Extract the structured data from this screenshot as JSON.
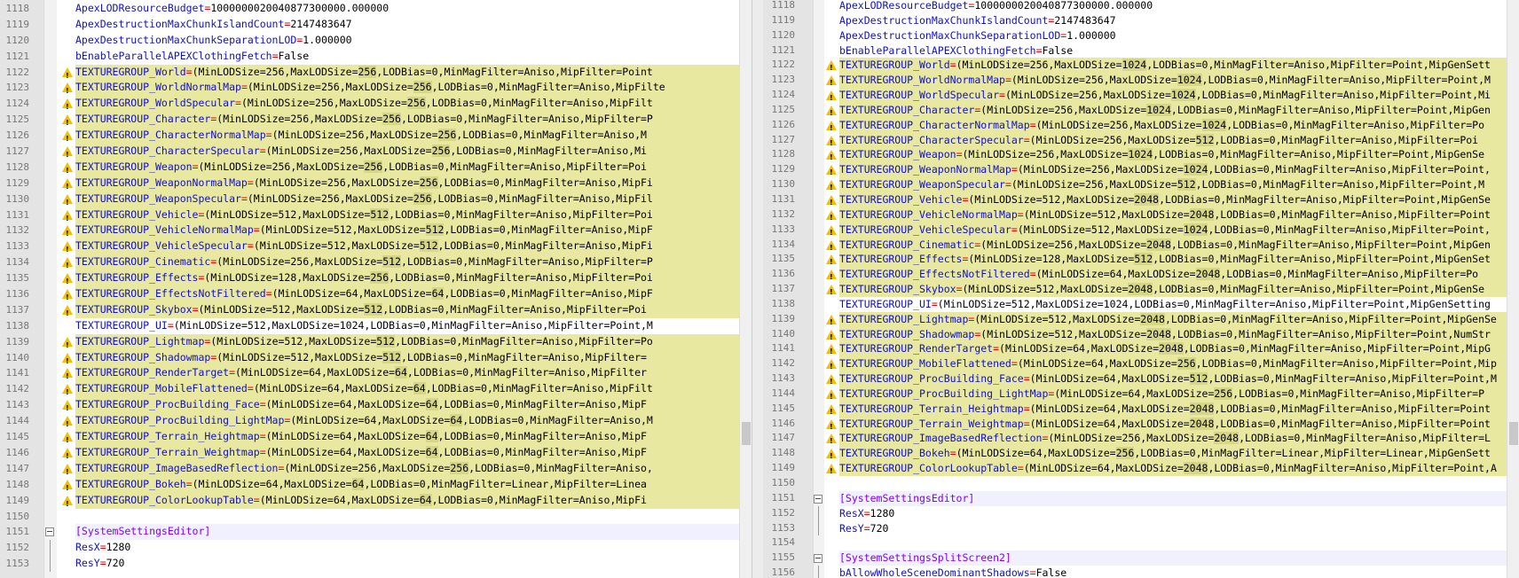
{
  "left_pane": {
    "lines": [
      {
        "num": "1118",
        "key": "ApexLODResourceBudget",
        "value": "1000000020040877300000.000000",
        "warn": false
      },
      {
        "num": "1119",
        "key": "ApexDestructionMaxChunkIslandCount",
        "value": "2147483647",
        "warn": false
      },
      {
        "num": "1120",
        "key": "ApexDestructionMaxChunkSeparationLOD",
        "value": "1.000000",
        "warn": false
      },
      {
        "num": "1121",
        "key": "bEnableParallelAPEXClothingFetch",
        "value": "False",
        "warn": false
      },
      {
        "num": "1122",
        "key": "TEXTUREGROUP_World",
        "pre": "(MinLODSize=256,MaxLODSize=",
        "mark": "256",
        "post": ",LODBias=0,MinMagFilter=Aniso,MipFilter=Point",
        "warn": true
      },
      {
        "num": "1123",
        "key": "TEXTUREGROUP_WorldNormalMap",
        "pre": "(MinLODSize=256,MaxLODSize=",
        "mark": "256",
        "post": ",LODBias=0,MinMagFilter=Aniso,MipFilte",
        "warn": true
      },
      {
        "num": "1124",
        "key": "TEXTUREGROUP_WorldSpecular",
        "pre": "(MinLODSize=256,MaxLODSize=",
        "mark": "256",
        "post": ",LODBias=0,MinMagFilter=Aniso,MipFilt",
        "warn": true
      },
      {
        "num": "1125",
        "key": "TEXTUREGROUP_Character",
        "pre": "(MinLODSize=256,MaxLODSize=",
        "mark": "256",
        "post": ",LODBias=0,MinMagFilter=Aniso,MipFilter=P",
        "warn": true
      },
      {
        "num": "1126",
        "key": "TEXTUREGROUP_CharacterNormalMap",
        "pre": "(MinLODSize=256,MaxLODSize=",
        "mark": "256",
        "post": ",LODBias=0,MinMagFilter=Aniso,M",
        "warn": true
      },
      {
        "num": "1127",
        "key": "TEXTUREGROUP_CharacterSpecular",
        "pre": "(MinLODSize=256,MaxLODSize=",
        "mark": "256",
        "post": ",LODBias=0,MinMagFilter=Aniso,Mi",
        "warn": true
      },
      {
        "num": "1128",
        "key": "TEXTUREGROUP_Weapon",
        "pre": "(MinLODSize=256,MaxLODSize=",
        "mark": "256",
        "post": ",LODBias=0,MinMagFilter=Aniso,MipFilter=Poi",
        "warn": true
      },
      {
        "num": "1129",
        "key": "TEXTUREGROUP_WeaponNormalMap",
        "pre": "(MinLODSize=256,MaxLODSize=",
        "mark": "256",
        "post": ",LODBias=0,MinMagFilter=Aniso,MipFi",
        "warn": true
      },
      {
        "num": "1130",
        "key": "TEXTUREGROUP_WeaponSpecular",
        "pre": "(MinLODSize=256,MaxLODSize=",
        "mark": "256",
        "post": ",LODBias=0,MinMagFilter=Aniso,MipFil",
        "warn": true
      },
      {
        "num": "1131",
        "key": "TEXTUREGROUP_Vehicle",
        "pre": "(MinLODSize=512,MaxLODSize=",
        "mark": "512",
        "post": ",LODBias=0,MinMagFilter=Aniso,MipFilter=Poi",
        "warn": true
      },
      {
        "num": "1132",
        "key": "TEXTUREGROUP_VehicleNormalMap",
        "pre": "(MinLODSize=512,MaxLODSize=",
        "mark": "512",
        "post": ",LODBias=0,MinMagFilter=Aniso,MipF",
        "warn": true
      },
      {
        "num": "1133",
        "key": "TEXTUREGROUP_VehicleSpecular",
        "pre": "(MinLODSize=512,MaxLODSize=",
        "mark": "512",
        "post": ",LODBias=0,MinMagFilter=Aniso,MipFi",
        "warn": true
      },
      {
        "num": "1134",
        "key": "TEXTUREGROUP_Cinematic",
        "pre": "(MinLODSize=256,MaxLODSize=",
        "mark": "512",
        "post": ",LODBias=0,MinMagFilter=Aniso,MipFilter=P",
        "warn": true
      },
      {
        "num": "1135",
        "key": "TEXTUREGROUP_Effects",
        "pre": "(MinLODSize=128,MaxLODSize=",
        "mark": "256",
        "post": ",LODBias=0,MinMagFilter=Aniso,MipFilter=Poi",
        "warn": true
      },
      {
        "num": "1136",
        "key": "TEXTUREGROUP_EffectsNotFiltered",
        "pre": "(MinLODSize=64,MaxLODSize=",
        "mark": "64",
        "post": ",LODBias=0,MinMagFilter=Aniso,MipF",
        "warn": true
      },
      {
        "num": "1137",
        "key": "TEXTUREGROUP_Skybox",
        "pre": "(MinLODSize=512,MaxLODSize=",
        "mark": "512",
        "post": ",LODBias=0,MinMagFilter=Aniso,MipFilter=Poi",
        "warn": true
      },
      {
        "num": "1138",
        "key": "TEXTUREGROUP_UI",
        "value": "(MinLODSize=512,MaxLODSize=1024,LODBias=0,MinMagFilter=Aniso,MipFilter=Point,M",
        "warn": false
      },
      {
        "num": "1139",
        "key": "TEXTUREGROUP_Lightmap",
        "pre": "(MinLODSize=512,MaxLODSize=",
        "mark": "512",
        "post": ",LODBias=0,MinMagFilter=Aniso,MipFilter=Po",
        "warn": true
      },
      {
        "num": "1140",
        "key": "TEXTUREGROUP_Shadowmap",
        "pre": "(MinLODSize=512,MaxLODSize=",
        "mark": "512",
        "post": ",LODBias=0,MinMagFilter=Aniso,MipFilter=",
        "warn": true
      },
      {
        "num": "1141",
        "key": "TEXTUREGROUP_RenderTarget",
        "pre": "(MinLODSize=64,MaxLODSize=",
        "mark": "64",
        "post": ",LODBias=0,MinMagFilter=Aniso,MipFilter",
        "warn": true
      },
      {
        "num": "1142",
        "key": "TEXTUREGROUP_MobileFlattened",
        "pre": "(MinLODSize=64,MaxLODSize=",
        "mark": "64",
        "post": ",LODBias=0,MinMagFilter=Aniso,MipFilt",
        "warn": true
      },
      {
        "num": "1143",
        "key": "TEXTUREGROUP_ProcBuilding_Face",
        "pre": "(MinLODSize=64,MaxLODSize=",
        "mark": "64",
        "post": ",LODBias=0,MinMagFilter=Aniso,MipF",
        "warn": true
      },
      {
        "num": "1144",
        "key": "TEXTUREGROUP_ProcBuilding_LightMap",
        "pre": "(MinLODSize=64,MaxLODSize=",
        "mark": "64",
        "post": ",LODBias=0,MinMagFilter=Aniso,M",
        "warn": true
      },
      {
        "num": "1145",
        "key": "TEXTUREGROUP_Terrain_Heightmap",
        "pre": "(MinLODSize=64,MaxLODSize=",
        "mark": "64",
        "post": ",LODBias=0,MinMagFilter=Aniso,MipF",
        "warn": true
      },
      {
        "num": "1146",
        "key": "TEXTUREGROUP_Terrain_Weightmap",
        "pre": "(MinLODSize=64,MaxLODSize=",
        "mark": "64",
        "post": ",LODBias=0,MinMagFilter=Aniso,MipF",
        "warn": true
      },
      {
        "num": "1147",
        "key": "TEXTUREGROUP_ImageBasedReflection",
        "pre": "(MinLODSize=256,MaxLODSize=",
        "mark": "256",
        "post": ",LODBias=0,MinMagFilter=Aniso,",
        "warn": true
      },
      {
        "num": "1148",
        "key": "TEXTUREGROUP_Bokeh",
        "pre": "(MinLODSize=64,MaxLODSize=",
        "mark": "64",
        "post": ",LODBias=0,MinMagFilter=Linear,MipFilter=Linea",
        "warn": true
      },
      {
        "num": "1149",
        "key": "TEXTUREGROUP_ColorLookupTable",
        "pre": "(MinLODSize=64,MaxLODSize=",
        "mark": "64",
        "post": ",LODBias=0,MinMagFilter=Aniso,MipFi",
        "warn": true
      },
      {
        "num": "1150",
        "blank": true
      },
      {
        "num": "1151",
        "section": "[SystemSettingsEditor]"
      },
      {
        "num": "1152",
        "key": "ResX",
        "value": "1280",
        "warn": false
      },
      {
        "num": "1153",
        "key": "ResY",
        "value": "720",
        "warn": false
      }
    ]
  },
  "right_pane": {
    "lines": [
      {
        "num": "1118",
        "key": "ApexLODResourceBudget",
        "value": "1000000020040877300000.000000",
        "warn": false
      },
      {
        "num": "1119",
        "key": "ApexDestructionMaxChunkIslandCount",
        "value": "2147483647",
        "warn": false
      },
      {
        "num": "1120",
        "key": "ApexDestructionMaxChunkSeparationLOD",
        "value": "1.000000",
        "warn": false
      },
      {
        "num": "1121",
        "key": "bEnableParallelAPEXClothingFetch",
        "value": "False",
        "warn": false
      },
      {
        "num": "1122",
        "key": "TEXTUREGROUP_World",
        "pre": "(MinLODSize=256,MaxLODSize=",
        "mark": "1024",
        "post": ",LODBias=0,MinMagFilter=Aniso,MipFilter=Point,MipGenSett",
        "warn": true
      },
      {
        "num": "1123",
        "key": "TEXTUREGROUP_WorldNormalMap",
        "pre": "(MinLODSize=256,MaxLODSize=",
        "mark": "1024",
        "post": ",LODBias=0,MinMagFilter=Aniso,MipFilter=Point,M",
        "warn": true
      },
      {
        "num": "1124",
        "key": "TEXTUREGROUP_WorldSpecular",
        "pre": "(MinLODSize=256,MaxLODSize=",
        "mark": "1024",
        "post": ",LODBias=0,MinMagFilter=Aniso,MipFilter=Point,Mi",
        "warn": true
      },
      {
        "num": "1125",
        "key": "TEXTUREGROUP_Character",
        "pre": "(MinLODSize=256,MaxLODSize=",
        "mark": "1024",
        "post": ",LODBias=0,MinMagFilter=Aniso,MipFilter=Point,MipGen",
        "warn": true
      },
      {
        "num": "1126",
        "key": "TEXTUREGROUP_CharacterNormalMap",
        "pre": "(MinLODSize=256,MaxLODSize=",
        "mark": "1024",
        "post": ",LODBias=0,MinMagFilter=Aniso,MipFilter=Po",
        "warn": true
      },
      {
        "num": "1127",
        "key": "TEXTUREGROUP_CharacterSpecular",
        "pre": "(MinLODSize=256,MaxLODSize=",
        "mark": "512",
        "post": ",LODBias=0,MinMagFilter=Aniso,MipFilter=Poi",
        "warn": true
      },
      {
        "num": "1128",
        "key": "TEXTUREGROUP_Weapon",
        "pre": "(MinLODSize=256,MaxLODSize=",
        "mark": "1024",
        "post": ",LODBias=0,MinMagFilter=Aniso,MipFilter=Point,MipGenSe",
        "warn": true
      },
      {
        "num": "1129",
        "key": "TEXTUREGROUP_WeaponNormalMap",
        "pre": "(MinLODSize=256,MaxLODSize=",
        "mark": "1024",
        "post": ",LODBias=0,MinMagFilter=Aniso,MipFilter=Point,",
        "warn": true
      },
      {
        "num": "1130",
        "key": "TEXTUREGROUP_WeaponSpecular",
        "pre": "(MinLODSize=256,MaxLODSize=",
        "mark": "512",
        "post": ",LODBias=0,MinMagFilter=Aniso,MipFilter=Point,M",
        "warn": true
      },
      {
        "num": "1131",
        "key": "TEXTUREGROUP_Vehicle",
        "pre": "(MinLODSize=512,MaxLODSize=",
        "mark": "2048",
        "post": ",LODBias=0,MinMagFilter=Aniso,MipFilter=Point,MipGenSe",
        "warn": true
      },
      {
        "num": "1132",
        "key": "TEXTUREGROUP_VehicleNormalMap",
        "pre": "(MinLODSize=512,MaxLODSize=",
        "mark": "2048",
        "post": ",LODBias=0,MinMagFilter=Aniso,MipFilter=Point",
        "warn": true
      },
      {
        "num": "1133",
        "key": "TEXTUREGROUP_VehicleSpecular",
        "pre": "(MinLODSize=512,MaxLODSize=",
        "mark": "1024",
        "post": ",LODBias=0,MinMagFilter=Aniso,MipFilter=Point,",
        "warn": true
      },
      {
        "num": "1134",
        "key": "TEXTUREGROUP_Cinematic",
        "pre": "(MinLODSize=256,MaxLODSize=",
        "mark": "2048",
        "post": ",LODBias=0,MinMagFilter=Aniso,MipFilter=Point,MipGen",
        "warn": true
      },
      {
        "num": "1135",
        "key": "TEXTUREGROUP_Effects",
        "pre": "(MinLODSize=128,MaxLODSize=",
        "mark": "512",
        "post": ",LODBias=0,MinMagFilter=Aniso,MipFilter=Point,MipGenSet",
        "warn": true
      },
      {
        "num": "1136",
        "key": "TEXTUREGROUP_EffectsNotFiltered",
        "pre": "(MinLODSize=64,MaxLODSize=",
        "mark": "2048",
        "post": ",LODBias=0,MinMagFilter=Aniso,MipFilter=Po",
        "warn": true
      },
      {
        "num": "1137",
        "key": "TEXTUREGROUP_Skybox",
        "pre": "(MinLODSize=512,MaxLODSize=",
        "mark": "2048",
        "post": ",LODBias=0,MinMagFilter=Aniso,MipFilter=Point,MipGenSe",
        "warn": true
      },
      {
        "num": "1138",
        "key": "TEXTUREGROUP_UI",
        "value": "(MinLODSize=512,MaxLODSize=1024,LODBias=0,MinMagFilter=Aniso,MipFilter=Point,MipGenSetting",
        "warn": false
      },
      {
        "num": "1139",
        "key": "TEXTUREGROUP_Lightmap",
        "pre": "(MinLODSize=512,MaxLODSize=",
        "mark": "2048",
        "post": ",LODBias=0,MinMagFilter=Aniso,MipFilter=Point,MipGenSe",
        "warn": true
      },
      {
        "num": "1140",
        "key": "TEXTUREGROUP_Shadowmap",
        "pre": "(MinLODSize=512,MaxLODSize=",
        "mark": "2048",
        "post": ",LODBias=0,MinMagFilter=Aniso,MipFilter=Point,NumStr",
        "warn": true
      },
      {
        "num": "1141",
        "key": "TEXTUREGROUP_RenderTarget",
        "pre": "(MinLODSize=64,MaxLODSize=",
        "mark": "2048",
        "post": ",LODBias=0,MinMagFilter=Aniso,MipFilter=Point,MipG",
        "warn": true
      },
      {
        "num": "1142",
        "key": "TEXTUREGROUP_MobileFlattened",
        "pre": "(MinLODSize=64,MaxLODSize=",
        "mark": "256",
        "post": ",LODBias=0,MinMagFilter=Aniso,MipFilter=Point,Mip",
        "warn": true
      },
      {
        "num": "1143",
        "key": "TEXTUREGROUP_ProcBuilding_Face",
        "pre": "(MinLODSize=64,MaxLODSize=",
        "mark": "512",
        "post": ",LODBias=0,MinMagFilter=Aniso,MipFilter=Point,M",
        "warn": true
      },
      {
        "num": "1144",
        "key": "TEXTUREGROUP_ProcBuilding_LightMap",
        "pre": "(MinLODSize=64,MaxLODSize=",
        "mark": "256",
        "post": ",LODBias=0,MinMagFilter=Aniso,MipFilter=P",
        "warn": true
      },
      {
        "num": "1145",
        "key": "TEXTUREGROUP_Terrain_Heightmap",
        "pre": "(MinLODSize=64,MaxLODSize=",
        "mark": "2048",
        "post": ",LODBias=0,MinMagFilter=Aniso,MipFilter=Point",
        "warn": true
      },
      {
        "num": "1146",
        "key": "TEXTUREGROUP_Terrain_Weightmap",
        "pre": "(MinLODSize=64,MaxLODSize=",
        "mark": "2048",
        "post": ",LODBias=0,MinMagFilter=Aniso,MipFilter=Point",
        "warn": true
      },
      {
        "num": "1147",
        "key": "TEXTUREGROUP_ImageBasedReflection",
        "pre": "(MinLODSize=256,MaxLODSize=",
        "mark": "2048",
        "post": ",LODBias=0,MinMagFilter=Aniso,MipFilter=L",
        "warn": true
      },
      {
        "num": "1148",
        "key": "TEXTUREGROUP_Bokeh",
        "pre": "(MinLODSize=64,MaxLODSize=",
        "mark": "256",
        "post": ",LODBias=0,MinMagFilter=Linear,MipFilter=Linear,MipGenSett",
        "warn": true
      },
      {
        "num": "1149",
        "key": "TEXTUREGROUP_ColorLookupTable",
        "pre": "(MinLODSize=64,MaxLODSize=",
        "mark": "2048",
        "post": ",LODBias=0,MinMagFilter=Aniso,MipFilter=Point,A",
        "warn": true
      },
      {
        "num": "1150",
        "blank": true
      },
      {
        "num": "1151",
        "section": "[SystemSettingsEditor]"
      },
      {
        "num": "1152",
        "key": "ResX",
        "value": "1280",
        "warn": false
      },
      {
        "num": "1153",
        "key": "ResY",
        "value": "720",
        "warn": false
      },
      {
        "num": "1154",
        "blank": true
      },
      {
        "num": "1155",
        "section": "[SystemSettingsSplitScreen2]"
      },
      {
        "num": "1156",
        "key": "bAllowWholeSceneDominantShadows",
        "value": "False",
        "warn": false
      }
    ]
  },
  "colors": {
    "highlight": "#e8e8a0",
    "diff_mark": "#d6d688",
    "key": "#1010c8",
    "section": "#8000ff",
    "equals": "#ee0000",
    "warning": "#f0c000"
  },
  "icons": {
    "warning": "warning-triangle-icon",
    "fold": "fold-collapse-icon"
  },
  "scroll": {
    "left_position": 0.76,
    "right_position": 0.76
  }
}
